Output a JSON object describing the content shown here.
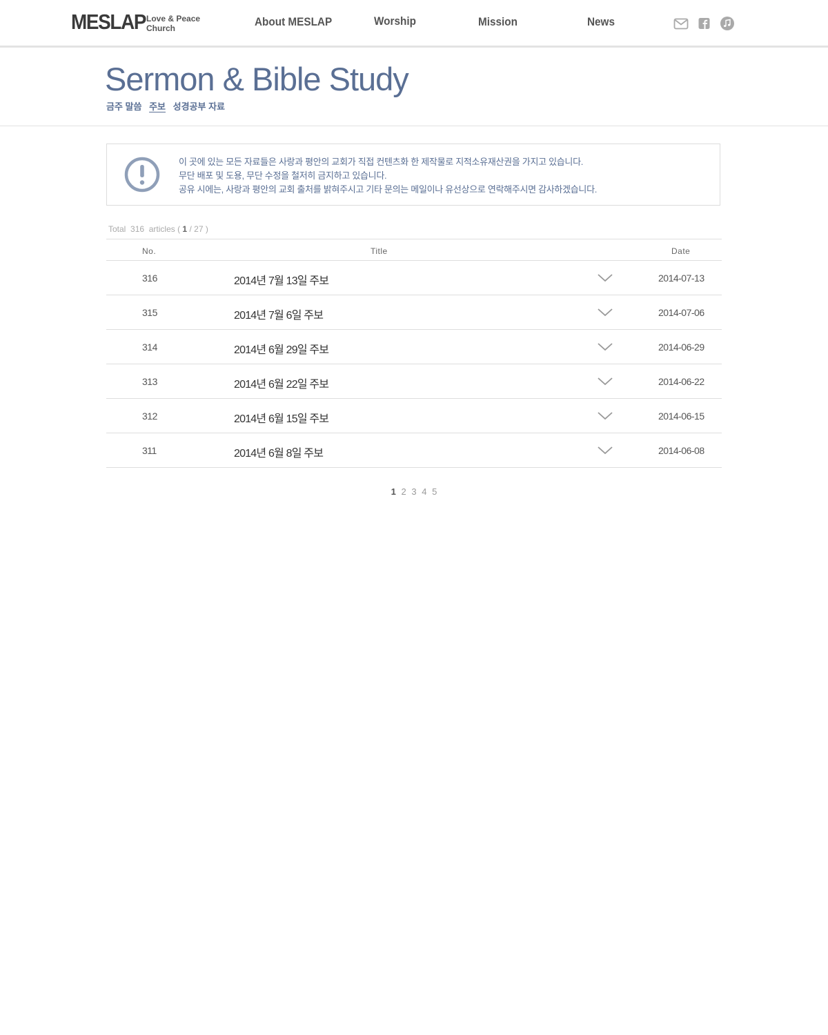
{
  "header": {
    "logo": "MESLAP",
    "tagline_line1": "Love & Peace",
    "tagline_line2": "Church",
    "nav": [
      {
        "label": "About MESLAP"
      },
      {
        "label": "Worship"
      },
      {
        "label": "Mission"
      },
      {
        "label": "News"
      }
    ],
    "icons": [
      "mail-icon",
      "facebook-icon",
      "music-icon"
    ]
  },
  "page": {
    "title": "Sermon & Bible Study",
    "subnav": [
      {
        "label": "금주 말씀"
      },
      {
        "label": "주보",
        "active": true
      },
      {
        "label": "성경공부 자료"
      }
    ]
  },
  "notice": {
    "lines": [
      "이 곳에 있는 모든 자료들은 사랑과 평안의 교회가 직접 컨텐츠화 한 제작물로 지적소유재산권을 가지고 있습니다.",
      "무단 배포 및 도용, 무단 수정을 철저히 금지하고 있습니다.",
      "공유 시에는, 사랑과 평안의 교회 출처를 밝혀주시고 기타 문의는 메일이나 유선상으로 연락해주시면 감사하겠습니다."
    ]
  },
  "list": {
    "total_label": "Total",
    "total_count": "316",
    "articles_label": "articles (",
    "current_page": "1",
    "page_sep": "/",
    "total_pages": "27",
    "close_paren": ")",
    "columns": {
      "no": "No.",
      "title": "Title",
      "date": "Date"
    },
    "rows": [
      {
        "no": "316",
        "title": "2014년 7월 13일 주보",
        "date": "2014-07-13"
      },
      {
        "no": "315",
        "title": "2014년 7월 6일 주보",
        "date": "2014-07-06"
      },
      {
        "no": "314",
        "title": "2014년 6월 29일 주보",
        "date": "2014-06-29"
      },
      {
        "no": "313",
        "title": "2014년 6월 22일 주보",
        "date": "2014-06-22"
      },
      {
        "no": "312",
        "title": "2014년 6월 15일 주보",
        "date": "2014-06-15"
      },
      {
        "no": "311",
        "title": "2014년 6월 8일 주보",
        "date": "2014-06-08"
      }
    ]
  },
  "pagination": {
    "pages": [
      "1",
      "2",
      "3",
      "4",
      "5"
    ],
    "current": "1"
  },
  "colors": {
    "accent": "#5a6f94",
    "icon_gray": "#a9a9a9",
    "divider": "#dedede"
  }
}
